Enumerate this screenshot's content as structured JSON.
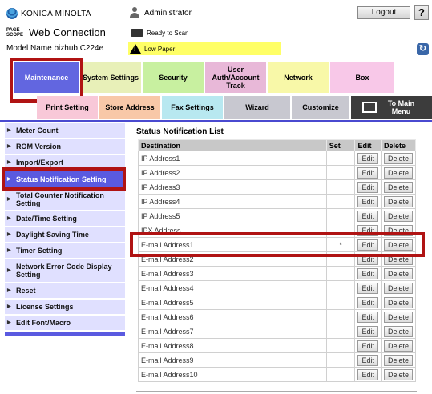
{
  "header": {
    "brand": "KONICA MINOLTA",
    "pagescope": "PAGE SCOPE",
    "product": "Web Connection",
    "model": "Model Name bizhub C224e",
    "user": "Administrator",
    "logout_label": "Logout",
    "help_label": "?",
    "status": "Ready to Scan",
    "warning": "Low Paper"
  },
  "tabs": {
    "maintenance": "Maintenance",
    "system_settings": "System Settings",
    "security": "Security",
    "user_auth": "User Auth/Account Track",
    "network": "Network",
    "box": "Box"
  },
  "subtabs": {
    "print_setting": "Print Setting",
    "store_address": "Store Address",
    "fax_settings": "Fax Settings",
    "wizard": "Wizard",
    "customize": "Customize",
    "to_main_menu": "To Main Menu"
  },
  "sidebar": {
    "items": [
      {
        "label": "Meter Count"
      },
      {
        "label": "ROM Version"
      },
      {
        "label": "Import/Export"
      },
      {
        "label": "Status Notification Setting"
      },
      {
        "label": "Total Counter Notification Setting"
      },
      {
        "label": "Date/Time Setting"
      },
      {
        "label": "Daylight Saving Time"
      },
      {
        "label": "Timer Setting"
      },
      {
        "label": "Network Error Code Display Setting"
      },
      {
        "label": "Reset"
      },
      {
        "label": "License Settings"
      },
      {
        "label": "Edit Font/Macro"
      }
    ]
  },
  "main": {
    "title": "Status Notification List",
    "columns": {
      "destination": "Destination",
      "set": "Set",
      "edit": "Edit",
      "delete": "Delete"
    },
    "edit_label": "Edit",
    "delete_label": "Delete",
    "rows": [
      {
        "destination": "IP Address1",
        "set": ""
      },
      {
        "destination": "IP Address2",
        "set": ""
      },
      {
        "destination": "IP Address3",
        "set": ""
      },
      {
        "destination": "IP Address4",
        "set": ""
      },
      {
        "destination": "IP Address5",
        "set": ""
      },
      {
        "destination": "IPX Address",
        "set": ""
      },
      {
        "destination": "E-mail Address1",
        "set": "*"
      },
      {
        "destination": "E-mail Address2",
        "set": ""
      },
      {
        "destination": "E-mail Address3",
        "set": ""
      },
      {
        "destination": "E-mail Address4",
        "set": ""
      },
      {
        "destination": "E-mail Address5",
        "set": ""
      },
      {
        "destination": "E-mail Address6",
        "set": ""
      },
      {
        "destination": "E-mail Address7",
        "set": ""
      },
      {
        "destination": "E-mail Address8",
        "set": ""
      },
      {
        "destination": "E-mail Address9",
        "set": ""
      },
      {
        "destination": "E-mail Address10",
        "set": ""
      }
    ]
  },
  "colors": {
    "accent": "#5a5ae0",
    "highlight": "#b01313",
    "warning_bg": "#ffff66"
  }
}
